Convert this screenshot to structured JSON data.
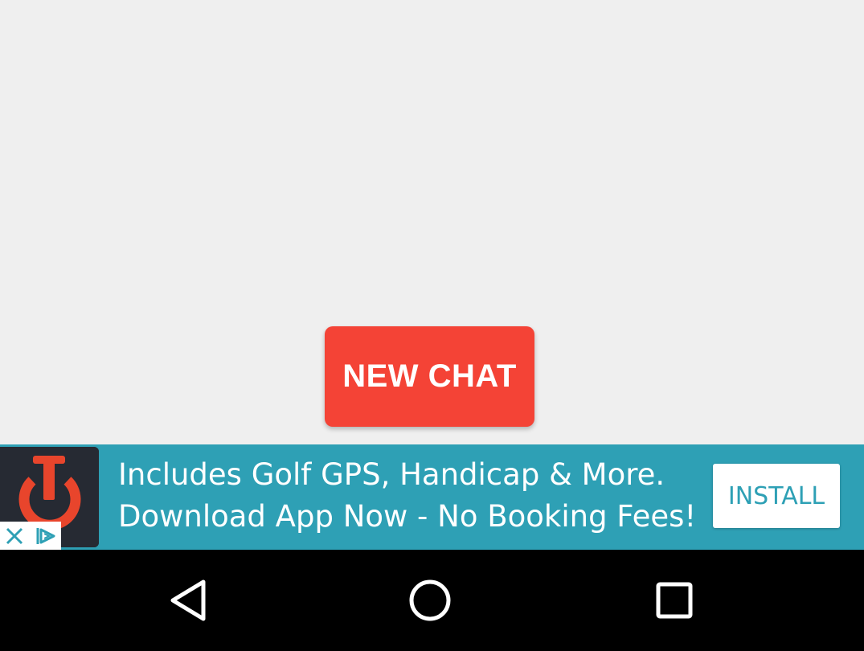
{
  "main": {
    "new_chat_label": "NEW CHAT"
  },
  "ad": {
    "line1": "Includes Golf GPS, Handicap & More.",
    "line2": "Download App Now - No Booking Fees!",
    "install_label": "INSTALL",
    "logo_icon": "golf-app-power-logo-icon",
    "close_icon": "close-icon",
    "adchoices_icon": "adchoices-icon"
  },
  "nav": {
    "back_icon": "back-triangle-icon",
    "home_icon": "home-circle-icon",
    "recents_icon": "recents-square-icon"
  },
  "colors": {
    "background": "#efefef",
    "accent_red": "#f44336",
    "ad_teal": "#2ea0b5",
    "nav_black": "#000000"
  }
}
